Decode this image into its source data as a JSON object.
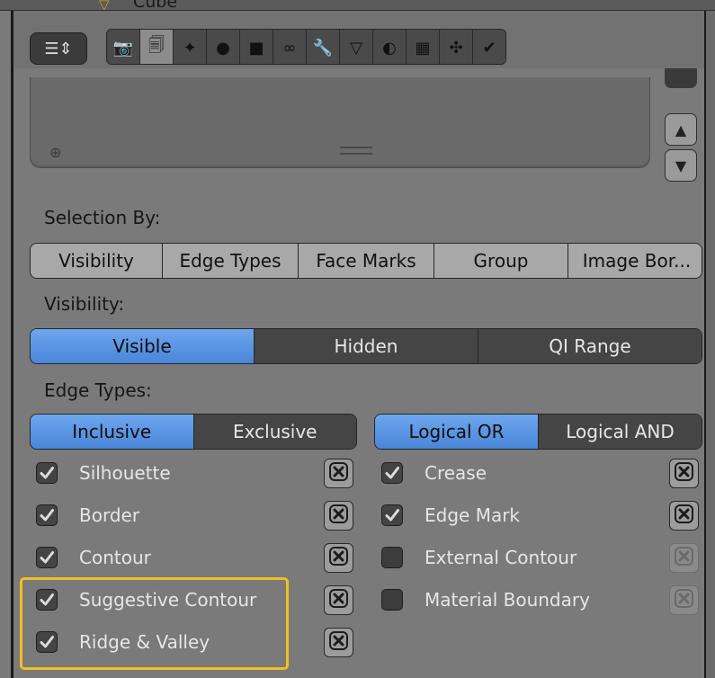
{
  "header": {
    "object_name": "Cube"
  },
  "toolbar": {
    "editor_icon": "properties-editor-icon",
    "tabs": [
      {
        "name": "render-icon",
        "glyph": "📷"
      },
      {
        "name": "render-layers-icon",
        "glyph": "🗐",
        "active": true
      },
      {
        "name": "scene-icon",
        "glyph": "✦"
      },
      {
        "name": "world-icon",
        "glyph": "●"
      },
      {
        "name": "object-icon",
        "glyph": "■"
      },
      {
        "name": "constraints-icon",
        "glyph": "∞"
      },
      {
        "name": "modifiers-icon",
        "glyph": "🔧"
      },
      {
        "name": "data-icon",
        "glyph": "▽"
      },
      {
        "name": "material-icon",
        "glyph": "◐"
      },
      {
        "name": "texture-icon",
        "glyph": "▦"
      },
      {
        "name": "particles-icon",
        "glyph": "✣"
      },
      {
        "name": "physics-icon",
        "glyph": "✔"
      }
    ]
  },
  "list": {
    "add_icon": "⊕",
    "up_icon": "▲",
    "down_icon": "▼"
  },
  "selection_by": {
    "label": "Selection By:",
    "options": [
      "Visibility",
      "Edge Types",
      "Face Marks",
      "Group",
      "Image Bor..."
    ]
  },
  "visibility": {
    "label": "Visibility:",
    "options": [
      "Visible",
      "Hidden",
      "QI Range"
    ],
    "selected": "Visible"
  },
  "edge_types": {
    "label": "Edge Types:",
    "mode_options": [
      "Inclusive",
      "Exclusive"
    ],
    "mode_selected": "Inclusive",
    "logic_options": [
      "Logical OR",
      "Logical AND"
    ],
    "logic_selected": "Logical OR",
    "left": [
      {
        "label": "Silhouette",
        "checked": true
      },
      {
        "label": "Border",
        "checked": true
      },
      {
        "label": "Contour",
        "checked": true
      },
      {
        "label": "Suggestive Contour",
        "checked": true
      },
      {
        "label": "Ridge & Valley",
        "checked": true
      }
    ],
    "right": [
      {
        "label": "Crease",
        "checked": true
      },
      {
        "label": "Edge Mark",
        "checked": true
      },
      {
        "label": "External Contour",
        "checked": false
      },
      {
        "label": "Material Boundary",
        "checked": false
      }
    ]
  },
  "colors": {
    "accent": "#5a93e0",
    "highlight": "#f2bf1e",
    "panel_bg": "#7a7a7a"
  }
}
